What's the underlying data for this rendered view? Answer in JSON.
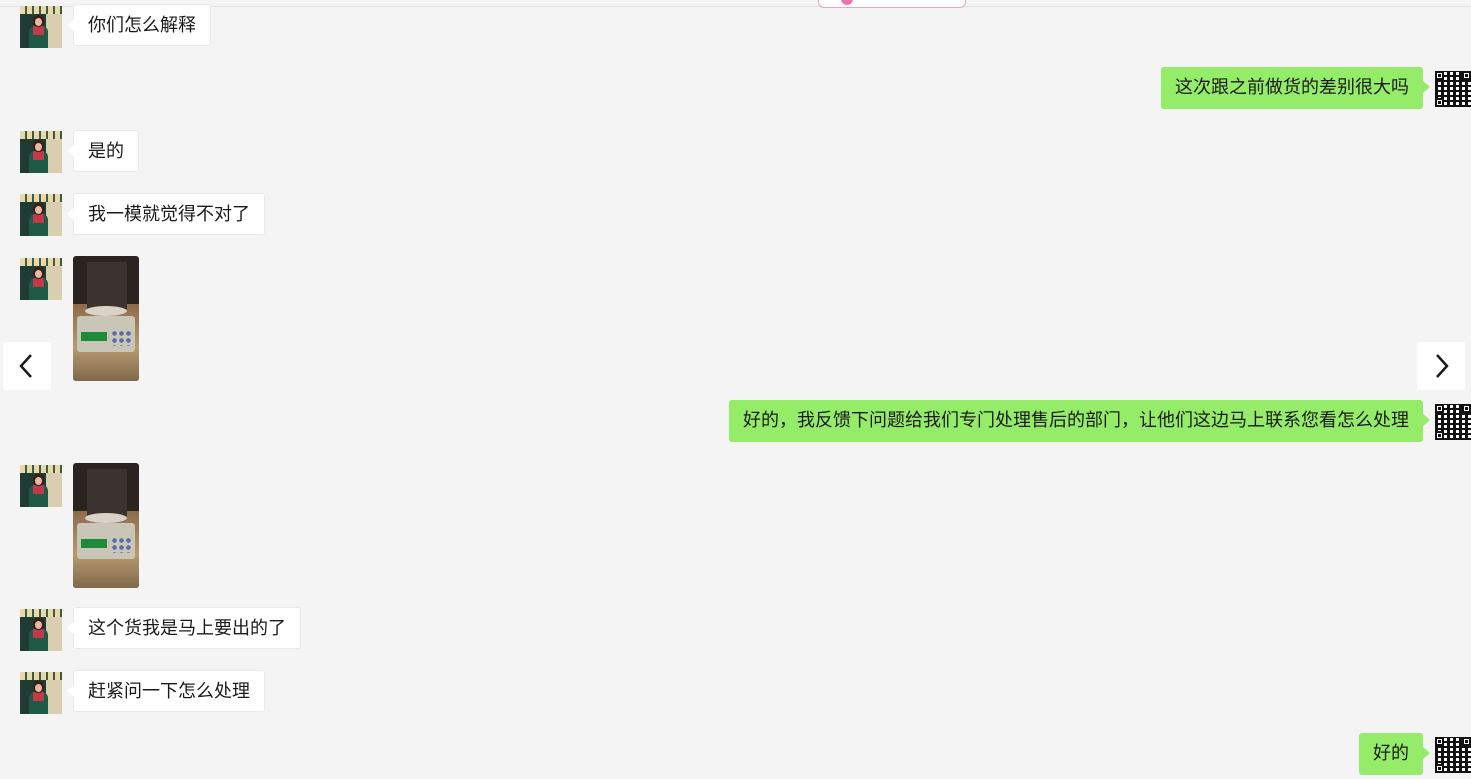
{
  "conversation": {
    "messages": [
      {
        "side": "left",
        "type": "text",
        "text": "你们怎么解释"
      },
      {
        "side": "right",
        "type": "text",
        "text": "这次跟之前做货的差别很大吗"
      },
      {
        "side": "left",
        "type": "text",
        "text": "是的"
      },
      {
        "side": "left",
        "type": "text",
        "text": "我一模就觉得不对了"
      },
      {
        "side": "left",
        "type": "image",
        "text": ""
      },
      {
        "side": "right",
        "type": "text",
        "text": "好的，我反馈下问题给我们专门处理售后的部门，让他们这边马上联系您看怎么处理"
      },
      {
        "side": "left",
        "type": "image",
        "text": ""
      },
      {
        "side": "left",
        "type": "text",
        "text": "这个货我是马上要出的了"
      },
      {
        "side": "left",
        "type": "text",
        "text": "赶紧问一下怎么处理"
      },
      {
        "side": "right",
        "type": "text",
        "text": "好的"
      }
    ]
  },
  "nav": {
    "prev_icon": "chevron-left-icon",
    "next_icon": "chevron-right-icon"
  },
  "colors": {
    "background": "#f4f4f4",
    "incoming_bubble": "#ffffff",
    "outgoing_bubble": "#95ec69",
    "text": "#1a1a1a"
  }
}
